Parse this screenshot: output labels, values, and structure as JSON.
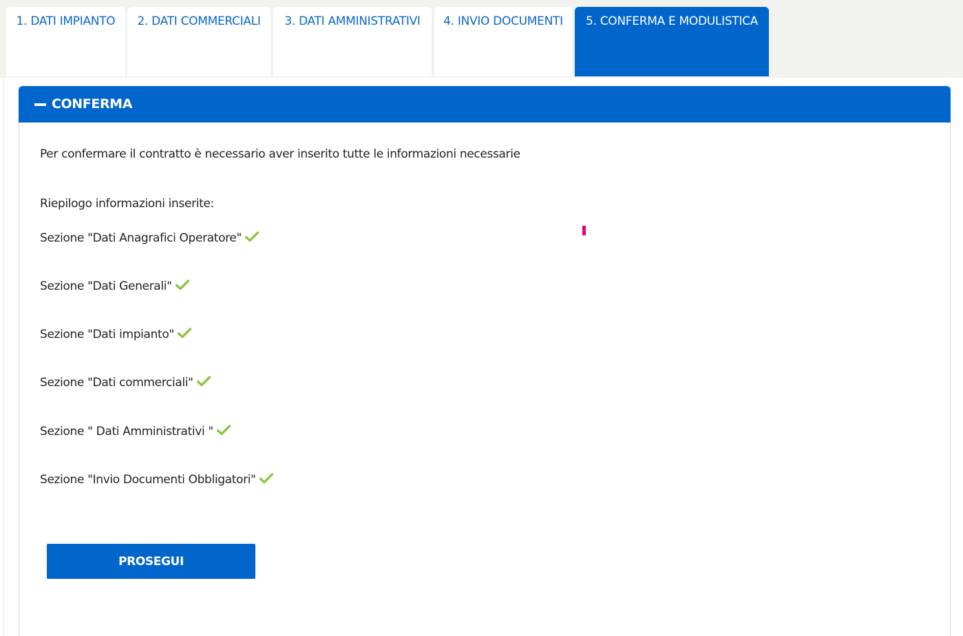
{
  "tabs": [
    {
      "label": "1. DATI IMPIANTO",
      "active": false
    },
    {
      "label": "2. DATI COMMERCIALI",
      "active": false
    },
    {
      "label": "3. DATI AMMINISTRATIVI",
      "active": false
    },
    {
      "label": "4. INVIO DOCUMENTI",
      "active": false
    },
    {
      "label": "5. CONFERMA E MODULISTICA",
      "active": true
    }
  ],
  "panel": {
    "title": "CONFERMA",
    "collapse_icon": "minus-icon",
    "intro": "Per confermare il contratto è necessario aver inserito tutte le informazioni necessarie",
    "summary_label": "Riepilogo informazioni inserite:",
    "sections": [
      {
        "label": "Sezione \"Dati Anagrafici Operatore\"",
        "status_icon": "check-icon"
      },
      {
        "label": "Sezione \"Dati Generali\"",
        "status_icon": "check-icon"
      },
      {
        "label": "Sezione \"Dati impianto\"",
        "status_icon": "check-icon"
      },
      {
        "label": "Sezione \"Dati commerciali\"",
        "status_icon": "check-icon"
      },
      {
        "label": "Sezione \" Dati Amministrativi \"",
        "status_icon": "check-icon"
      },
      {
        "label": "Sezione \"Invio Documenti Obbligatori\"",
        "status_icon": "check-icon"
      }
    ],
    "continue_label": "PROSEGUI"
  },
  "colors": {
    "accent": "#0066cc",
    "tab_text": "#0a66c8",
    "check": "#8cc63f",
    "cursor_mark": "#e6007e"
  }
}
